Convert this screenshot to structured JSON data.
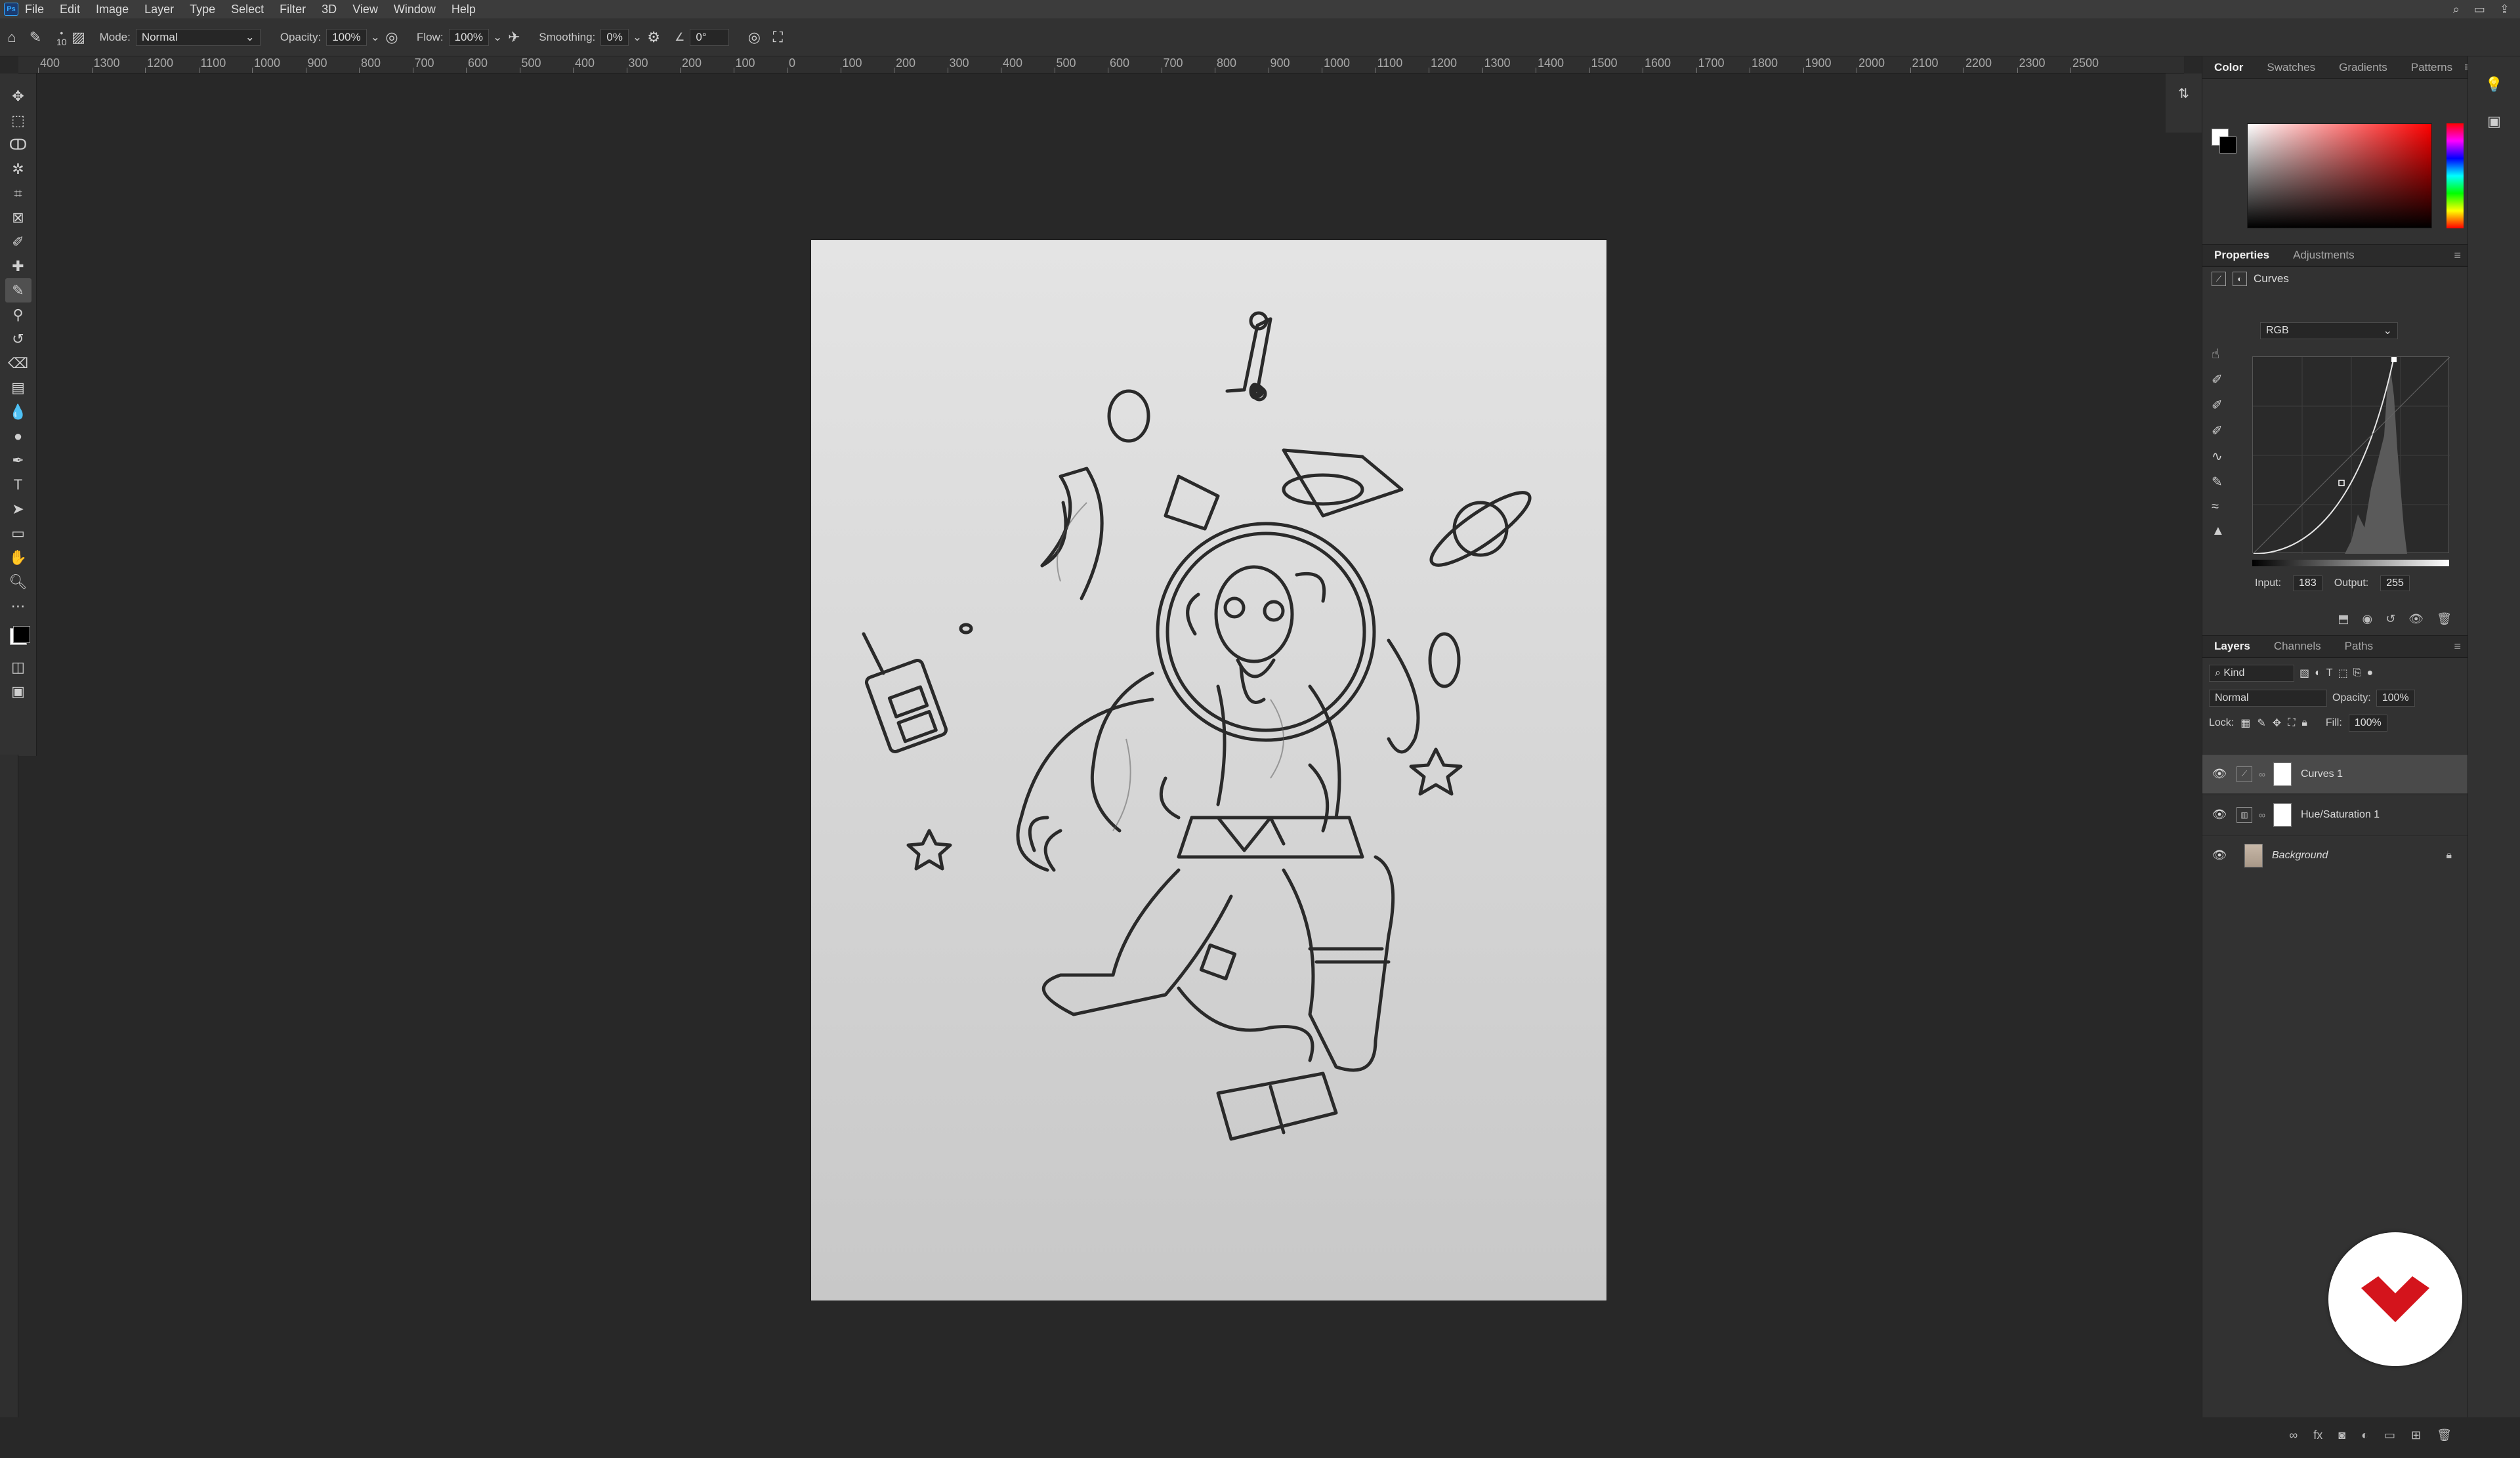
{
  "menu": {
    "items": [
      "File",
      "Edit",
      "Image",
      "Layer",
      "Type",
      "Select",
      "Filter",
      "3D",
      "View",
      "Window",
      "Help"
    ],
    "logo_text": "Ps"
  },
  "options": {
    "brush_size": "10",
    "mode_label": "Mode:",
    "mode_value": "Normal",
    "opacity_label": "Opacity:",
    "opacity_value": "100%",
    "flow_label": "Flow:",
    "flow_value": "100%",
    "smoothing_label": "Smoothing:",
    "smoothing_value": "0%",
    "angle_value": "0°"
  },
  "ruler": {
    "ticks": [
      "400",
      "1300",
      "1200",
      "1100",
      "1000",
      "900",
      "800",
      "700",
      "600",
      "500",
      "400",
      "300",
      "200",
      "100",
      "0",
      "100",
      "200",
      "300",
      "400",
      "500",
      "600",
      "700",
      "800",
      "900",
      "1000",
      "1100",
      "1200",
      "1300",
      "1400",
      "1500",
      "1600",
      "1700",
      "1800",
      "1900",
      "2000",
      "2100",
      "2200",
      "2300",
      "2500"
    ]
  },
  "color_panel": {
    "tabs": [
      "Color",
      "Swatches",
      "Gradients",
      "Patterns"
    ],
    "active_tab": "Color"
  },
  "properties": {
    "tabs": [
      "Properties",
      "Adjustments"
    ],
    "active_tab": "Properties",
    "title": "Curves",
    "preset": "RGB",
    "input_label": "Input:",
    "input_value": "183",
    "output_label": "Output:",
    "output_value": "255"
  },
  "layers": {
    "tabs": [
      "Layers",
      "Channels",
      "Paths"
    ],
    "active_tab": "Layers",
    "kind_label": "Kind",
    "blend_mode": "Normal",
    "opacity_label": "Opacity:",
    "opacity_value": "100%",
    "lock_label": "Lock:",
    "fill_label": "Fill:",
    "fill_value": "100%",
    "items": [
      {
        "name": "Curves 1",
        "type": "adjustment",
        "active": true
      },
      {
        "name": "Hue/Saturation 1",
        "type": "adjustment",
        "active": false
      },
      {
        "name": "Background",
        "type": "image",
        "active": false,
        "locked": true
      }
    ]
  },
  "colors": {
    "accent_red": "#d4141c",
    "panel_bg": "#323232",
    "canvas_bg": "#282828"
  }
}
